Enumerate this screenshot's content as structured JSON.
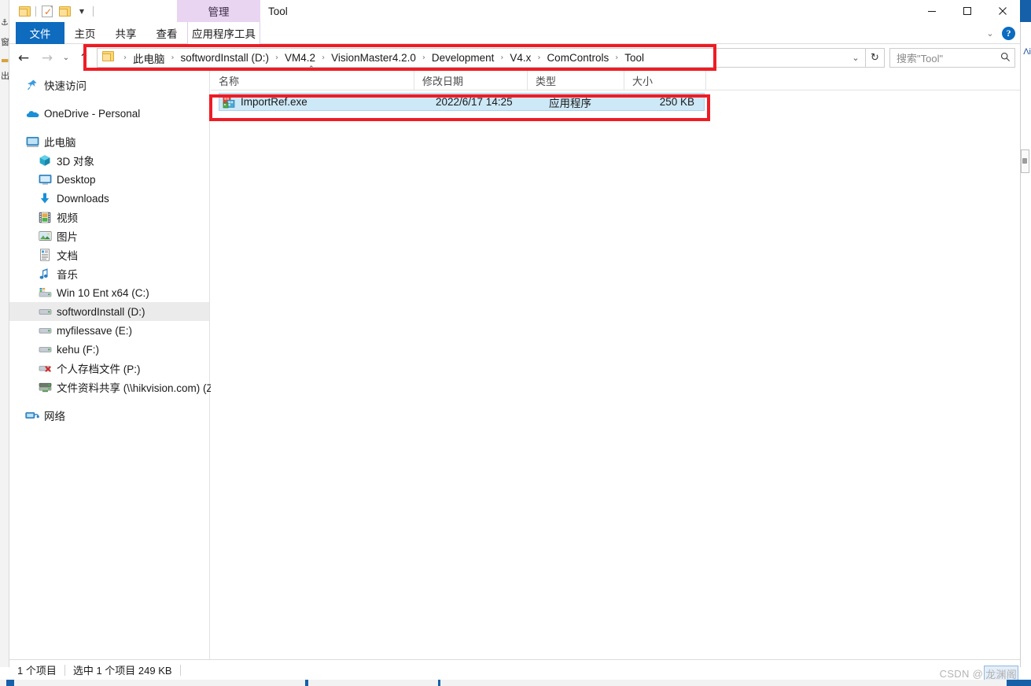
{
  "window": {
    "title": "Tool",
    "contextual_tab_header": "管理",
    "controls": {
      "minimize": "minimize-icon",
      "maximize": "maximize-icon",
      "close": "close-icon"
    }
  },
  "quick_access_toolbar": {
    "items": [
      {
        "name": "folder-icon",
        "label": ""
      },
      {
        "name": "properties-icon",
        "label": ""
      },
      {
        "name": "new-folder-icon",
        "label": ""
      },
      {
        "name": "customize-caret-icon",
        "label": "▼"
      }
    ]
  },
  "ribbon": {
    "tabs": [
      {
        "label": "文件",
        "active": true
      },
      {
        "label": "主页",
        "active": false
      },
      {
        "label": "共享",
        "active": false
      },
      {
        "label": "查看",
        "active": false
      },
      {
        "label": "应用程序工具",
        "active": false,
        "contextual": true
      }
    ],
    "collapse_caret": "⌄",
    "help_label": "?"
  },
  "navigation": {
    "back": "←",
    "forward": "→",
    "history": "⌄",
    "up": "↑"
  },
  "address": {
    "crumbs": [
      "此电脑",
      "softwordInstall (D:)",
      "VM4.2",
      "VisionMaster4.2.0",
      "Development",
      "V4.x",
      "ComControls",
      "Tool"
    ],
    "separator": "›",
    "dropdown_caret": "⌄",
    "refresh": "↻"
  },
  "search": {
    "placeholder": "搜索\"Tool\"",
    "icon": "search-icon"
  },
  "nav_pane": {
    "items": [
      {
        "label": "快速访问",
        "icon": "pin-star-icon",
        "indent": 0,
        "selected": false
      },
      {
        "label": "OneDrive - Personal",
        "icon": "onedrive-cloud-icon",
        "indent": 0,
        "selected": false
      },
      {
        "label": "此电脑",
        "icon": "this-pc-monitor-icon",
        "indent": 0,
        "selected": false
      },
      {
        "label": "3D 对象",
        "icon": "3d-objects-icon",
        "indent": 1,
        "selected": false
      },
      {
        "label": "Desktop",
        "icon": "desktop-icon",
        "indent": 1,
        "selected": false
      },
      {
        "label": "Downloads",
        "icon": "downloads-arrow-icon",
        "indent": 1,
        "selected": false
      },
      {
        "label": "视频",
        "icon": "videos-film-icon",
        "indent": 1,
        "selected": false
      },
      {
        "label": "图片",
        "icon": "pictures-icon",
        "indent": 1,
        "selected": false
      },
      {
        "label": "文档",
        "icon": "documents-icon",
        "indent": 1,
        "selected": false
      },
      {
        "label": "音乐",
        "icon": "music-note-icon",
        "indent": 1,
        "selected": false
      },
      {
        "label": "Win 10 Ent x64 (C:)",
        "icon": "system-drive-icon",
        "indent": 1,
        "selected": false
      },
      {
        "label": "softwordInstall (D:)",
        "icon": "drive-icon",
        "indent": 1,
        "selected": true
      },
      {
        "label": "myfilessave (E:)",
        "icon": "drive-icon",
        "indent": 1,
        "selected": false
      },
      {
        "label": "kehu (F:)",
        "icon": "drive-icon",
        "indent": 1,
        "selected": false
      },
      {
        "label": "个人存档文件 (P:)",
        "icon": "disconnected-drive-icon",
        "indent": 1,
        "selected": false
      },
      {
        "label": "文件资料共享 (\\\\hikvision.com) (Z:)",
        "icon": "network-drive-icon",
        "indent": 1,
        "selected": false
      },
      {
        "label": "网络",
        "icon": "network-icon",
        "indent": 0,
        "selected": false
      }
    ]
  },
  "file_list": {
    "columns": [
      {
        "label": "名称",
        "sorted": true,
        "sort_caret": "⌃"
      },
      {
        "label": "修改日期",
        "sorted": false,
        "sort_caret": ""
      },
      {
        "label": "类型",
        "sorted": false,
        "sort_caret": ""
      },
      {
        "label": "大小",
        "sorted": false,
        "sort_caret": ""
      }
    ],
    "rows": [
      {
        "name": "ImportRef.exe",
        "modified": "2022/6/17 14:25",
        "type": "应用程序",
        "size": "250 KB",
        "icon": "exe-application-icon",
        "selected": true
      }
    ]
  },
  "status_bar": {
    "item_count": "1 个项目",
    "selection": "选中 1 个项目  249 KB"
  },
  "watermark": {
    "prefix": "CSDN @",
    "author": "龙渊阁"
  },
  "annotations": {
    "boxes": [
      {
        "name": "address-bar-highlight",
        "color": "#ee1c25"
      },
      {
        "name": "file-row-highlight",
        "color": "#ee1c25"
      }
    ]
  }
}
